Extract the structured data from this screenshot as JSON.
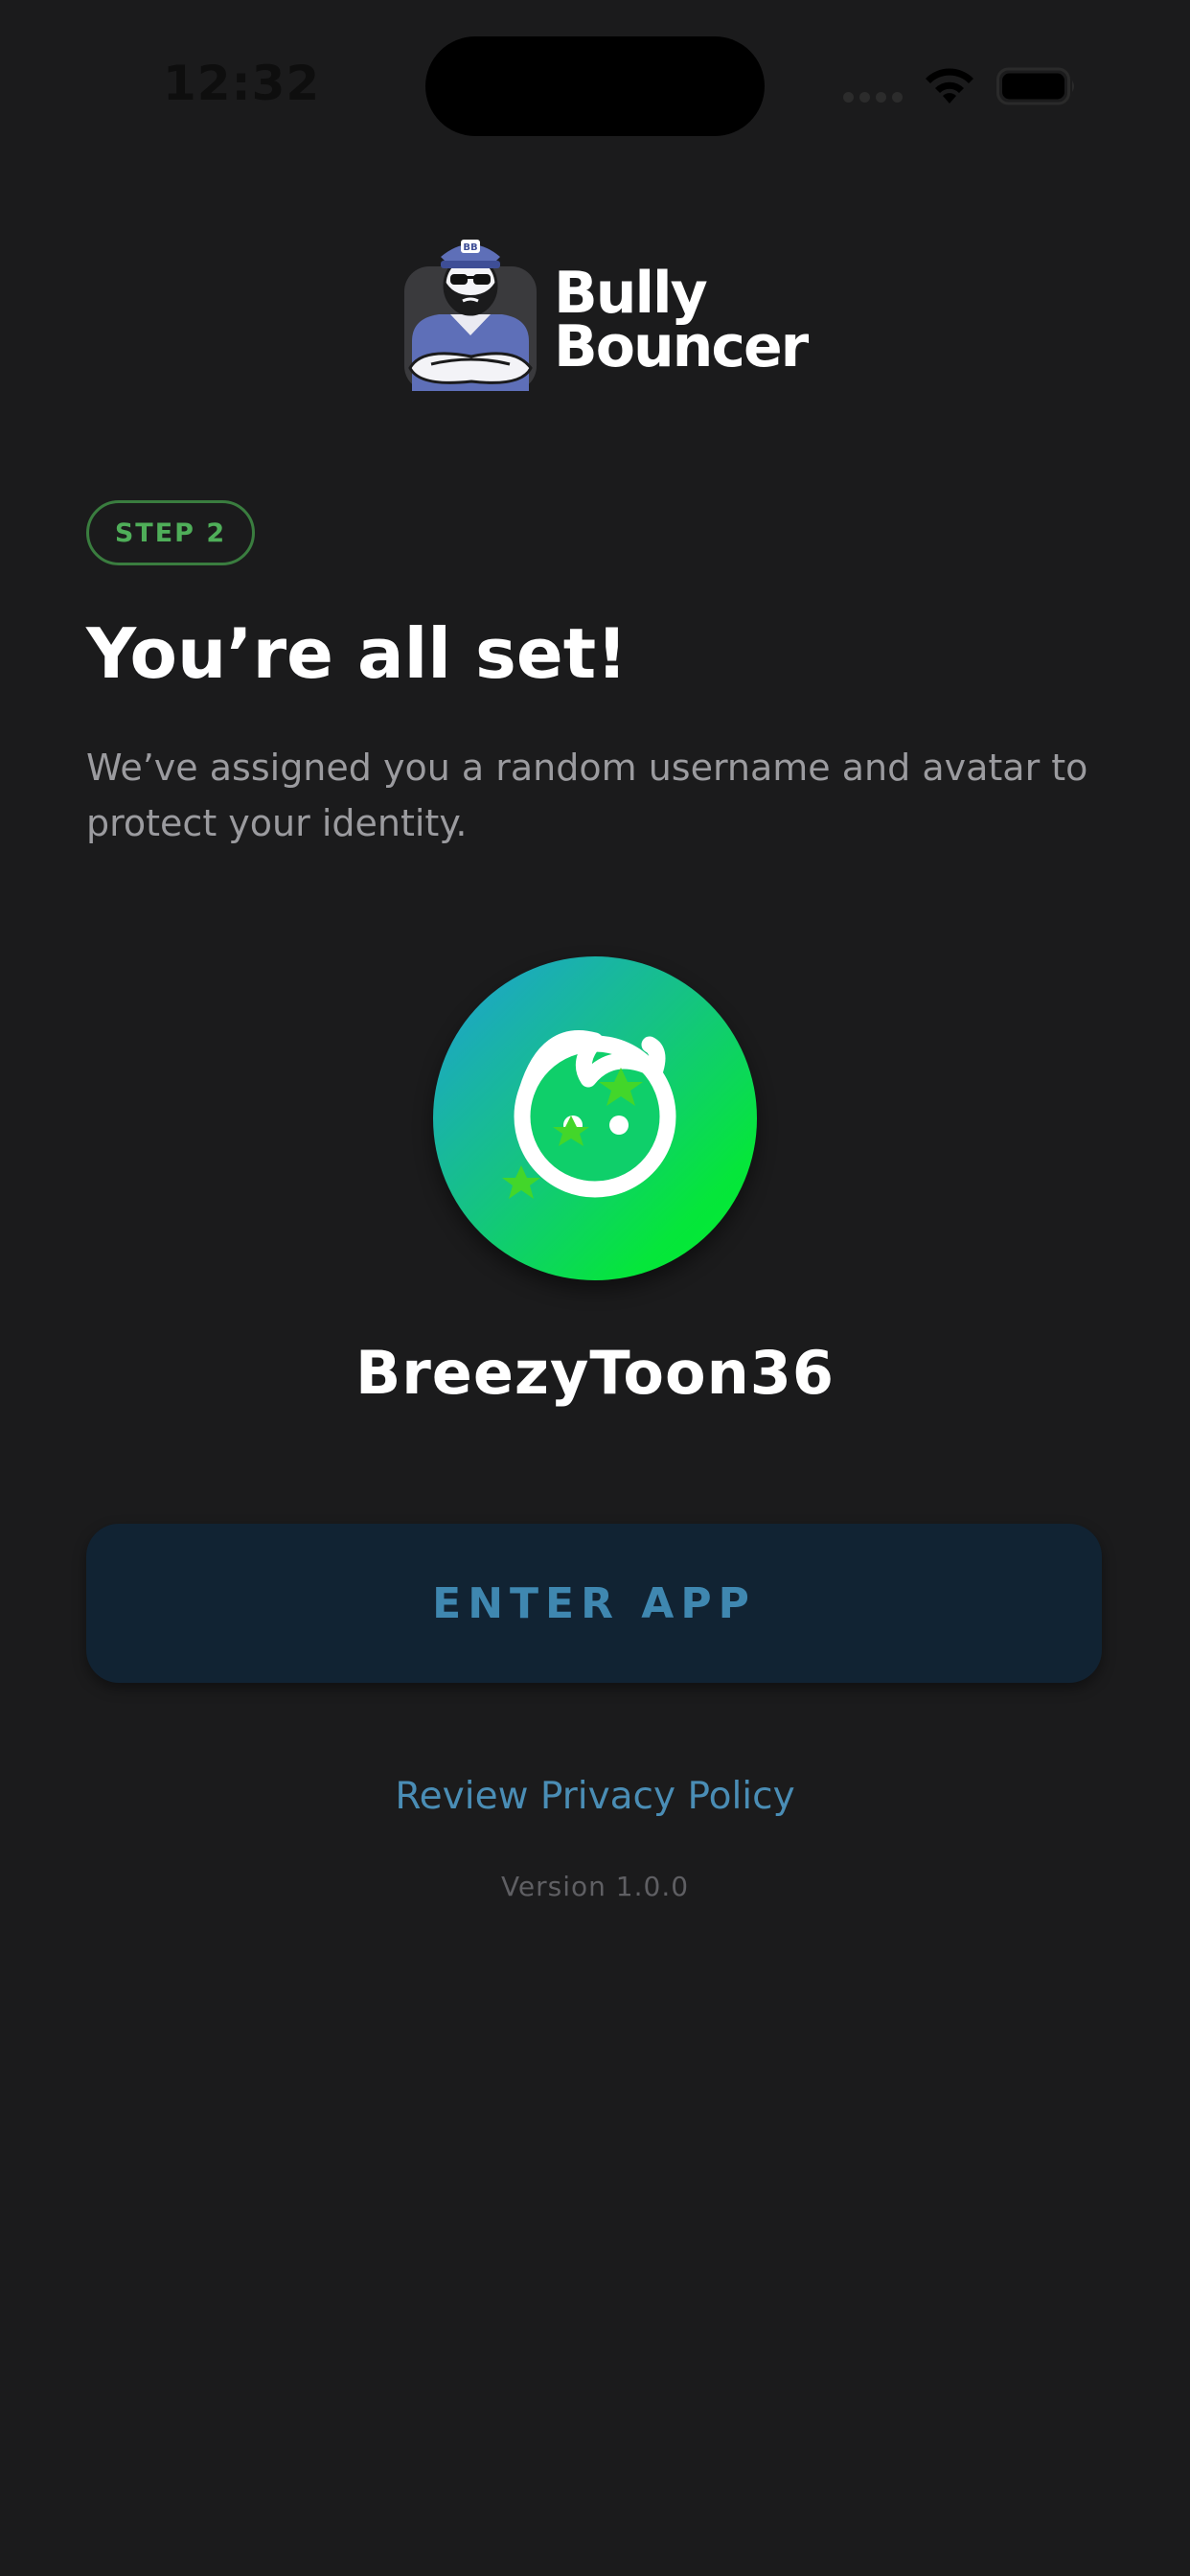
{
  "status_bar": {
    "time": "12:32",
    "icons": [
      "signal-dots-icon",
      "wifi-icon",
      "battery-icon"
    ]
  },
  "logo": {
    "line1": "Bully",
    "line2": "Bouncer",
    "badge_text": "BB",
    "icon": "bouncer-mascot-icon"
  },
  "step": {
    "label": "STEP 2"
  },
  "heading": {
    "title": "You’re all set!",
    "subtitle": "We’ve assigned you a random username and avatar to protect your identity."
  },
  "profile": {
    "avatar_icon": "face-with-stars-icon",
    "username": "BreezyToon36"
  },
  "actions": {
    "enter_label": "ENTER APP",
    "privacy_label": "Review Privacy Policy"
  },
  "footer": {
    "version": "Version 1.0.0"
  },
  "colors": {
    "background": "#1b1b1c",
    "step_green": "#4fae59",
    "button_bg": "#112333",
    "button_text": "#3f87b0",
    "link": "#4a8db5"
  }
}
